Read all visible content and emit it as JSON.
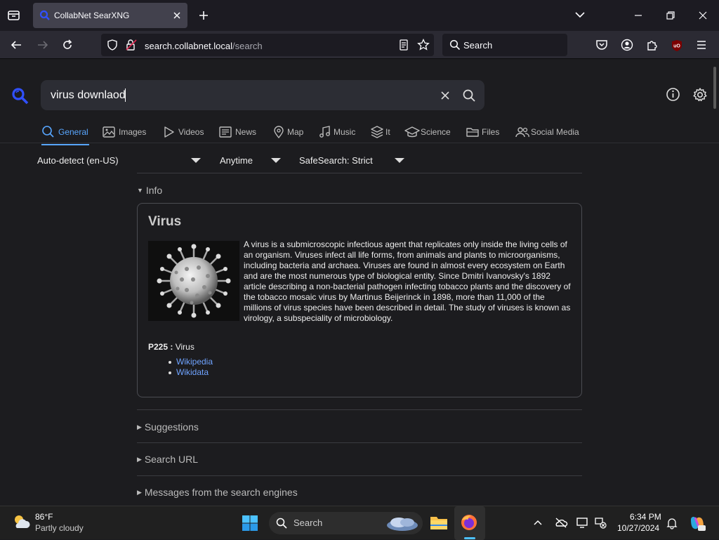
{
  "browser": {
    "tab_title": "CollabNet SearXNG",
    "url_host": "search.collabnet.local",
    "url_path": "/search",
    "search_placeholder": "Search"
  },
  "search": {
    "query": "virus downlaod"
  },
  "categories": [
    {
      "label": "General",
      "icon": "search-icon"
    },
    {
      "label": "Images",
      "icon": "image-icon"
    },
    {
      "label": "Videos",
      "icon": "play-icon"
    },
    {
      "label": "News",
      "icon": "newspaper-icon"
    },
    {
      "label": "Map",
      "icon": "map-pin-icon"
    },
    {
      "label": "Music",
      "icon": "music-icon"
    },
    {
      "label": "It",
      "icon": "layers-icon"
    },
    {
      "label": "Science",
      "icon": "graduation-cap-icon"
    },
    {
      "label": "Files",
      "icon": "folder-icon"
    },
    {
      "label": "Social Media",
      "icon": "people-icon"
    }
  ],
  "filters": {
    "language": "Auto-detect (en-US)",
    "time": "Anytime",
    "safesearch": "SafeSearch: Strict"
  },
  "sections": {
    "info": "Info",
    "suggestions": "Suggestions",
    "search_url": "Search URL",
    "messages": "Messages from the search engines"
  },
  "infobox": {
    "title": "Virus",
    "text": "A virus is a submicroscopic infectious agent that replicates only inside the living cells of an organism. Viruses infect all life forms, from animals and plants to microorganisms, including bacteria and archaea. Viruses are found in almost every ecosystem on Earth and are the most numerous type of biological entity. Since Dmitri Ivanovsky's 1892 article describing a non-bacterial pathogen infecting tobacco plants and the discovery of the tobacco mosaic virus by Martinus Beijerinck in 1898, more than 11,000 of the millions of virus species have been described in detail. The study of viruses is known as virology, a subspeciality of microbiology.",
    "property_key": "P225 :",
    "property_value": "Virus",
    "links": [
      "Wikipedia",
      "Wikidata"
    ]
  },
  "taskbar": {
    "temp": "86°F",
    "weather": "Partly cloudy",
    "search_label": "Search",
    "time": "6:34 PM",
    "date": "10/27/2024"
  },
  "colors": {
    "accent": "#58a6ff",
    "link": "#6fa3ff",
    "logo": "#3050ff"
  }
}
